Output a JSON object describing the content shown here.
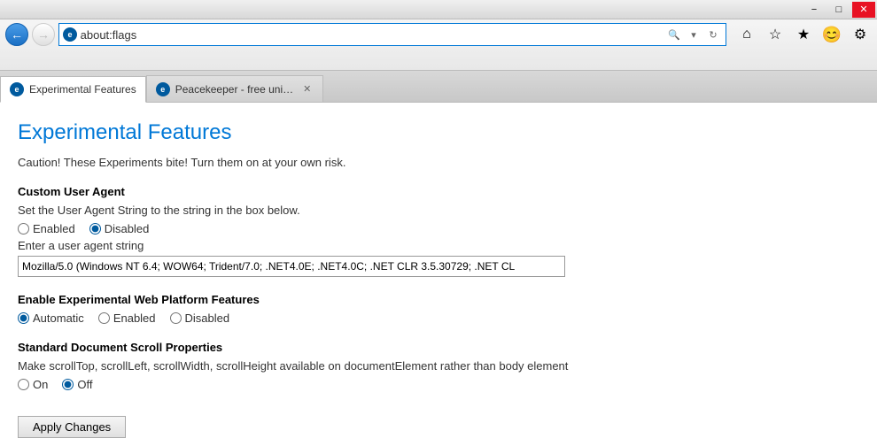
{
  "titlebar": {
    "minimize_label": "−",
    "maximize_label": "□",
    "close_label": "✕"
  },
  "nav": {
    "back_icon": "←",
    "forward_icon": "→",
    "address": "about:flags",
    "search_icon": "🔍",
    "refresh_icon": "↻"
  },
  "toolbar": {
    "home_icon": "⌂",
    "star_icon": "☆",
    "bookmark_icon": "★",
    "smiley_icon": "😊",
    "gear_icon": "⚙"
  },
  "tabs": [
    {
      "label": "Experimental Features",
      "active": true,
      "favicon": "ie"
    },
    {
      "label": "Peacekeeper - free universa...",
      "active": false,
      "favicon": "ie"
    }
  ],
  "page": {
    "title": "Experimental Features",
    "caution": "Caution! These Experiments bite! Turn them on at your own risk.",
    "features": [
      {
        "id": "custom-user-agent",
        "title": "Custom User Agent",
        "desc": "Set the User Agent String to the string in the box below.",
        "options": [
          "Enabled",
          "Disabled"
        ],
        "selected": "Disabled",
        "has_input": true,
        "input_label": "Enter a user agent string",
        "input_value": "Mozilla/5.0 (Windows NT 6.4; WOW64; Trident/7.0; .NET4.0E; .NET4.0C; .NET CLR 3.5.30729; .NET CL"
      },
      {
        "id": "experimental-web-platform",
        "title": "Enable Experimental Web Platform Features",
        "desc": "",
        "options": [
          "Automatic",
          "Enabled",
          "Disabled"
        ],
        "selected": "Automatic",
        "has_input": false
      },
      {
        "id": "standard-document-scroll",
        "title": "Standard Document Scroll Properties",
        "desc": "Make scrollTop, scrollLeft, scrollWidth, scrollHeight available on documentElement rather than body element",
        "options": [
          "On",
          "Off"
        ],
        "selected": "Off",
        "has_input": false
      }
    ],
    "apply_btn": "Apply Changes"
  }
}
